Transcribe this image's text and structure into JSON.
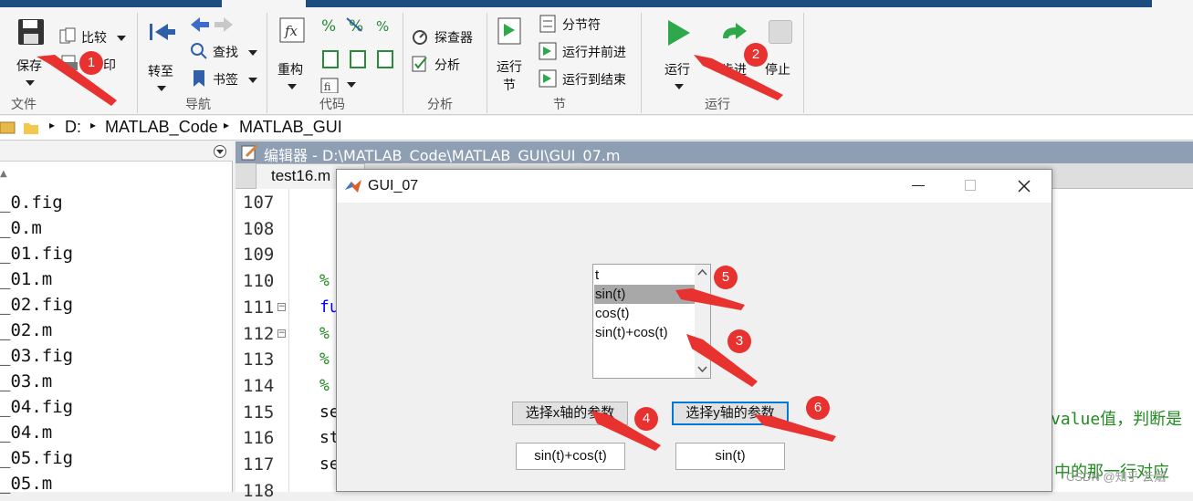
{
  "ribbon": {
    "groups": {
      "file": "文件",
      "nav": "导航",
      "code": "代码",
      "analyze": "分析",
      "section": "节",
      "run": "运行"
    },
    "save": "保存",
    "compare": "比较",
    "print_partial": "印",
    "goto": "转至",
    "find": "查找",
    "bookmark": "书签",
    "refactor": "重构",
    "profiler": "探查器",
    "analyze": "分析",
    "run_section": "运行\n节",
    "section_break": "分节符",
    "run_and_advance": "运行并前进",
    "run_to_end": "运行到结束",
    "run": "运行",
    "step": "步进",
    "stop": "停止"
  },
  "address": {
    "drive": "D:",
    "folder1": "MATLAB_Code",
    "folder2": "MATLAB_GUI"
  },
  "files": [
    "_0.fig",
    "_0.m",
    "_01.fig",
    "_01.m",
    "_02.fig",
    "_02.m",
    "_03.fig",
    "_03.m",
    "_04.fig",
    "_04.m",
    "_05.fig",
    "_05.m"
  ],
  "editor": {
    "title": "编辑器 - D:\\MATLAB_Code\\MATLAB_GUI\\GUI_07.m",
    "tab": "test16.m",
    "line_numbers": [
      "107",
      "108",
      "109",
      "110",
      "111",
      "112",
      "113",
      "114",
      "115",
      "116",
      "117",
      "118"
    ],
    "code_fragments": [
      "%",
      "fu",
      "%",
      "%",
      "%",
      "se",
      "st",
      "se"
    ],
    "right_fragment_1": "value值，判断是",
    "right_fragment_2": "中的那一行对应"
  },
  "gui": {
    "title": "GUI_07",
    "list_items": [
      "t",
      "sin(t)",
      "cos(t)",
      "sin(t)+cos(t)"
    ],
    "selected_index": 1,
    "btn_x": "选择x轴的参数",
    "btn_y": "选择y轴的参数",
    "x_value": "sin(t)+cos(t)",
    "y_value": "sin(t)"
  },
  "annotations": [
    "1",
    "2",
    "3",
    "4",
    "5",
    "6"
  ],
  "watermark": "CSDN @知乎 云烟",
  "colors": {
    "marker": "#e8322f",
    "title_bar": "#1d4d7e",
    "editor_title": "#8e9fb3",
    "run_green": "#2ea84a",
    "comment_green": "#228b22",
    "keyword_blue": "#0000ff"
  }
}
